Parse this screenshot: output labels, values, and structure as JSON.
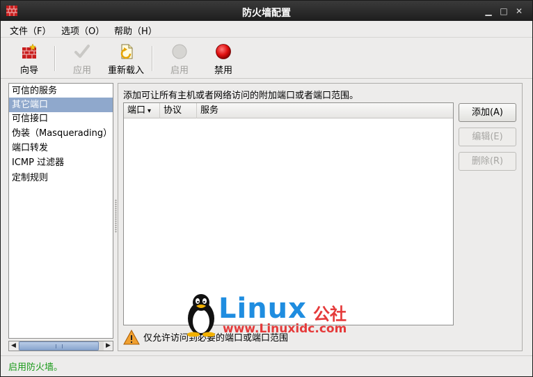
{
  "window": {
    "title": "防火墙配置"
  },
  "menubar": {
    "items": [
      {
        "label": "文件（F）"
      },
      {
        "label": "选项（O）"
      },
      {
        "label": "帮助（H）"
      }
    ]
  },
  "toolbar": {
    "items": [
      {
        "label": "向导",
        "icon": "wizard-icon",
        "enabled": true
      },
      {
        "label": "应用",
        "icon": "apply-checkmark-icon",
        "enabled": false
      },
      {
        "label": "重新载入",
        "icon": "reload-icon",
        "enabled": true
      },
      {
        "label": "启用",
        "icon": "enable-gray-circle-icon",
        "enabled": false
      },
      {
        "label": "禁用",
        "icon": "disable-red-circle-icon",
        "enabled": true
      }
    ]
  },
  "sidebar": {
    "items": [
      {
        "label": "可信的服务",
        "selected": false
      },
      {
        "label": "其它端口",
        "selected": true
      },
      {
        "label": "可信接口",
        "selected": false
      },
      {
        "label": "伪装（Masquerading）",
        "selected": false
      },
      {
        "label": "端口转发",
        "selected": false
      },
      {
        "label": "ICMP 过滤器",
        "selected": false
      },
      {
        "label": "定制规则",
        "selected": false
      }
    ]
  },
  "main": {
    "description": "添加可让所有主机或者网络访问的附加端口或者端口范围。",
    "table": {
      "columns": [
        {
          "label": "端口"
        },
        {
          "label": "协议"
        },
        {
          "label": "服务"
        }
      ],
      "rows": []
    },
    "buttons": {
      "add": "添加(A)",
      "edit": "编辑(E)",
      "remove": "删除(R)"
    },
    "warning": "仅允许访问到必要的端口或端口范围"
  },
  "watermark": {
    "brand": "Linux",
    "brand_cn": "公社",
    "url": "www.Linuxidc.com"
  },
  "statusbar": {
    "text": "启用防火墙。"
  },
  "colors": {
    "selection": "#8fa8cc",
    "status_text": "#1a9a1a",
    "disable_red": "#e01010",
    "titlebar": "#2b2b2b"
  }
}
